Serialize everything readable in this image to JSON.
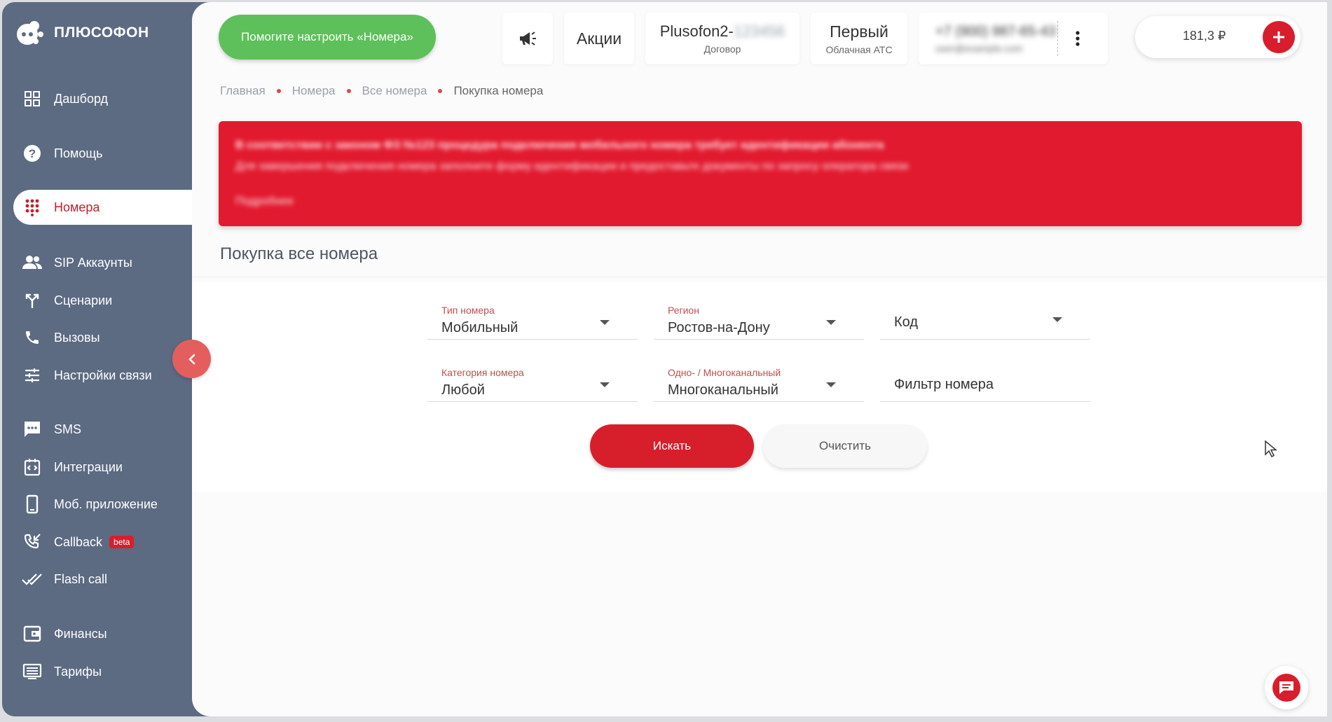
{
  "brand": {
    "name": "ПЛЮСОФОН"
  },
  "sidebar": {
    "items": [
      {
        "label": "Дашборд",
        "icon": "dashboard-icon"
      },
      {
        "label": "Помощь",
        "icon": "help-icon"
      },
      {
        "label": "Номера",
        "icon": "dialpad-icon",
        "active": true
      },
      {
        "label": "SIP Аккаунты",
        "icon": "users-icon"
      },
      {
        "label": "Сценарии",
        "icon": "fork-icon"
      },
      {
        "label": "Вызовы",
        "icon": "phone-icon"
      },
      {
        "label": "Настройки связи",
        "icon": "sliders-icon"
      },
      {
        "label": "SMS",
        "icon": "sms-icon"
      },
      {
        "label": "Интеграции",
        "icon": "integration-icon"
      },
      {
        "label": "Моб. приложение",
        "icon": "mobile-icon"
      },
      {
        "label": "Callback",
        "icon": "callback-icon",
        "badge": "beta"
      },
      {
        "label": "Flash call",
        "icon": "double-check-icon"
      },
      {
        "label": "Финансы",
        "icon": "wallet-icon"
      },
      {
        "label": "Тарифы",
        "icon": "list-icon"
      }
    ]
  },
  "topbar": {
    "help_button": "Помогите настроить «Номера»",
    "promo_label": "Акции",
    "account": {
      "name": "Plusofon2-",
      "name_hidden": "123456",
      "sub": "Договор"
    },
    "tariff": {
      "name": "Первый",
      "sub": "Облачная АТС"
    },
    "phone": {
      "number_hidden": "+7 (900) 987-65-43",
      "sub_hidden": "user@example.com"
    },
    "balance": "181,3 ₽"
  },
  "breadcrumb": {
    "items": [
      "Главная",
      "Номера",
      "Все номера"
    ],
    "current": "Покупка номера"
  },
  "alert": {
    "line1": "В соответствии с законом ФЗ №123 процедура подключения мобильного номера требует идентификации абонента",
    "line2": "Для завершения подключения номера заполните форму идентификации и предоставьте документы по запросу оператора связи",
    "line3": "Подробнее"
  },
  "page_title": "Покупка все номера",
  "form": {
    "type": {
      "label": "Тип номера",
      "value": "Мобильный"
    },
    "region": {
      "label": "Регион",
      "value": "Ростов-на-Дону"
    },
    "code": {
      "placeholder": "Код"
    },
    "category": {
      "label": "Категория номера",
      "value": "Любой"
    },
    "channels": {
      "label": "Одно- / Многоканальный",
      "value": "Многоканальный"
    },
    "filter": {
      "placeholder": "Фильтр номера"
    },
    "search_button": "Искать",
    "clear_button": "Очистить"
  },
  "colors": {
    "sidebar_bg": "#5c6a82",
    "accent_red": "#d71f2c",
    "alert_red": "#e21a2f",
    "help_green": "#5dc05a"
  }
}
